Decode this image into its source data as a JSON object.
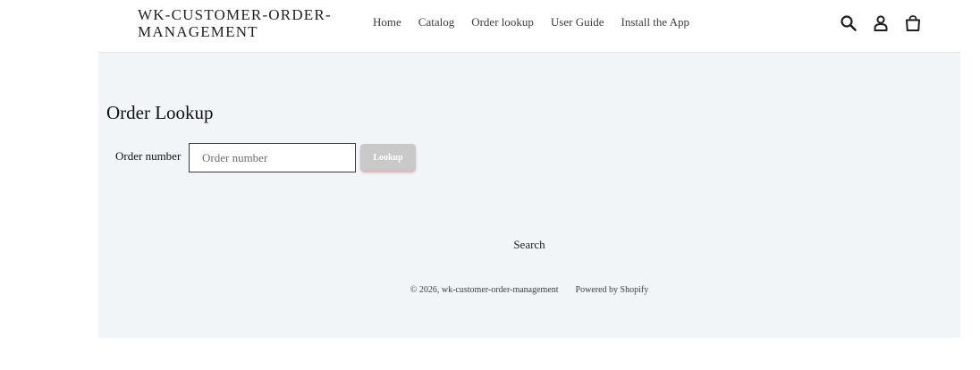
{
  "header": {
    "logo": "WK-CUSTOMER-ORDER-MANAGEMENT",
    "nav": [
      "Home",
      "Catalog",
      "Order lookup",
      "User Guide",
      "Install the App"
    ],
    "icons": [
      "search-icon",
      "account-icon",
      "cart-icon"
    ]
  },
  "main": {
    "title": "Order Lookup",
    "label": "Order number",
    "input_placeholder": "Order number",
    "input_value": "",
    "button_label": "Lookup"
  },
  "footer": {
    "search_link": "Search",
    "copyright": "© 2026, wk-customer-order-management",
    "powered_by": "Powered by Shopify"
  },
  "colors": {
    "content_background": "#f2f5f8",
    "button_background": "#c9c9c9",
    "text": "#1a1a1a"
  }
}
